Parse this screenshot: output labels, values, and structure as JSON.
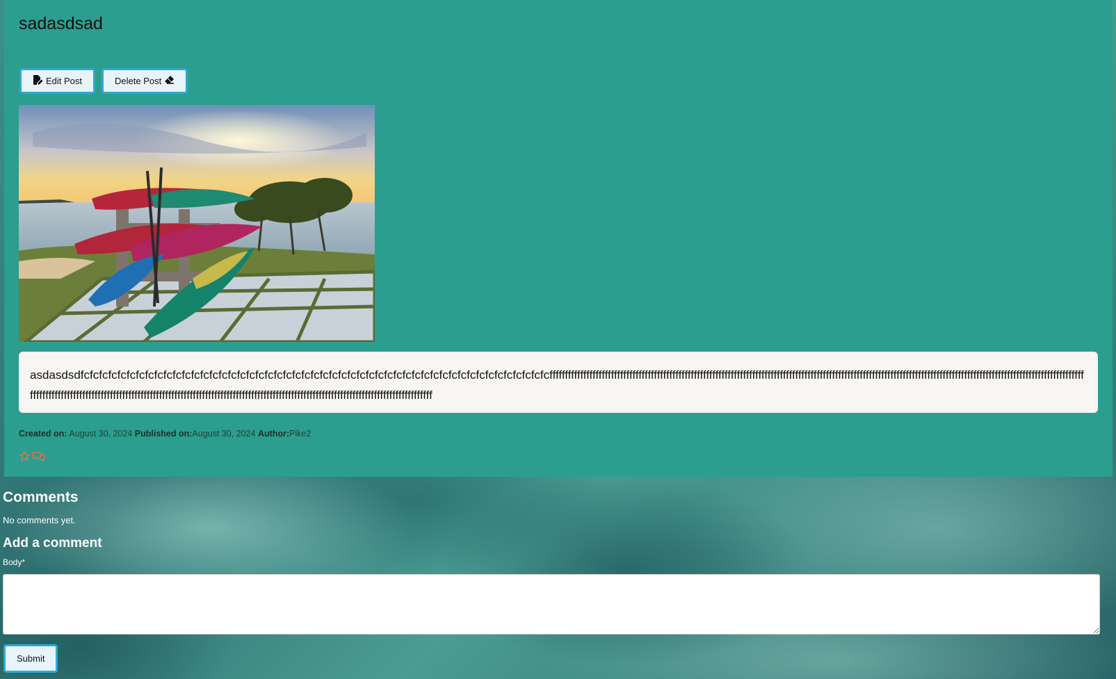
{
  "post": {
    "title": "sadasdsad",
    "edit_label": "Edit Post",
    "delete_label": "Delete Post",
    "body": "asdasdsdfcfcfcfcfcfcfcfcfcfcfcfcfcfcfcfcfcfcfcfcfcfcfcfcfcfcfcfcfcfcfcfcfcfcfcfcfcfcfcfcfcfcfcfcfcfcfcfcfcfcfcfffffffffffffffffffffffffffffffffffffffffffffffffffffffffffffffffffffffffffffffffffffffffffffffffffffffffffffffffffffffffffffffffffffffffffffffffffffffffffffffffffffffffffffffffffffffffffffffffffffffffffffffffffffffffffffffffffffffffffffffffffffffffffffffffffffffffffffffffffffffffffffffffffffffffffffffff",
    "meta": {
      "created_label": "Created on:",
      "created_value": " August 30, 2024 ",
      "published_label": "Published on:",
      "published_value": "August 30, 2024 ",
      "author_label": "Author:",
      "author_value": "Pike2"
    }
  },
  "comments": {
    "heading": "Comments",
    "empty_text": "No comments yet.",
    "add_heading": "Add a comment",
    "body_label": "Body*",
    "submit_label": "Submit"
  },
  "icons": {
    "edit": "file-pen-icon",
    "delete": "eraser-icon",
    "favorite": "star-icon",
    "comment": "comment-icon"
  },
  "colors": {
    "card_background": "#2b9e8f",
    "button_border": "#2fa9d4",
    "icon_accent": "#e8734a"
  }
}
